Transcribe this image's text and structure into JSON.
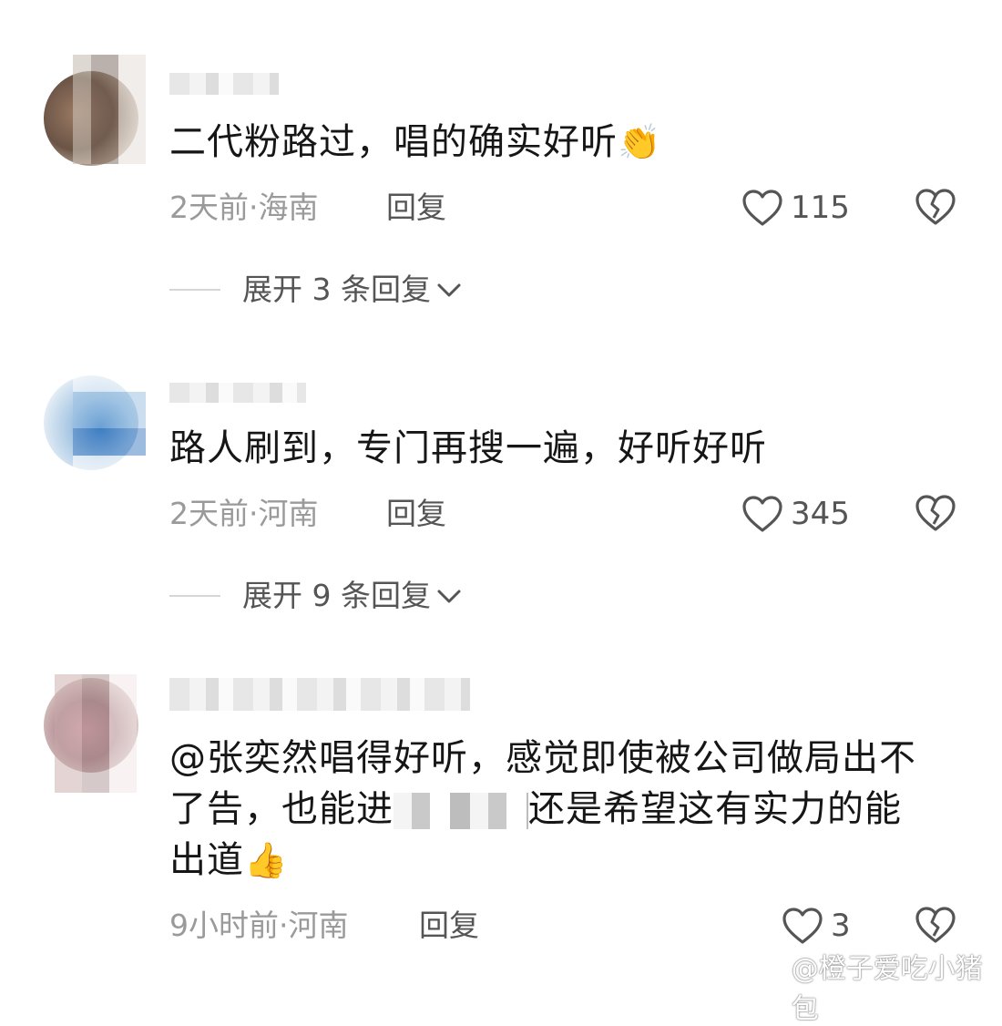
{
  "comments": [
    {
      "text": "二代粉路过，唱的确实好听",
      "emoji": "👏",
      "meta": "2天前·海南",
      "reply_label": "回复",
      "likes": "115",
      "expand": "展开 3 条回复"
    },
    {
      "text": "路人刷到，专门再搜一遍，好听好听",
      "emoji": "",
      "meta": "2天前·河南",
      "reply_label": "回复",
      "likes": "345",
      "expand": "展开 9 条回复"
    },
    {
      "text_line1": "@张奕然唱得好听，感觉即使被公司做局出不",
      "text_line2_a": "了告，也能进",
      "text_line2_b": "还是希望这有实力的能",
      "text_line3": "出道",
      "emoji": "👍",
      "meta": "9小时前·河南",
      "reply_label": "回复",
      "likes": "3"
    }
  ],
  "watermark": "@橙子爱吃小猪包",
  "colors": {
    "muted": "#9a9a9a",
    "icon": "#555555"
  },
  "icons": [
    "heart-icon",
    "broken-heart-icon",
    "chevron-down-icon",
    "weibo-logo-icon"
  ]
}
